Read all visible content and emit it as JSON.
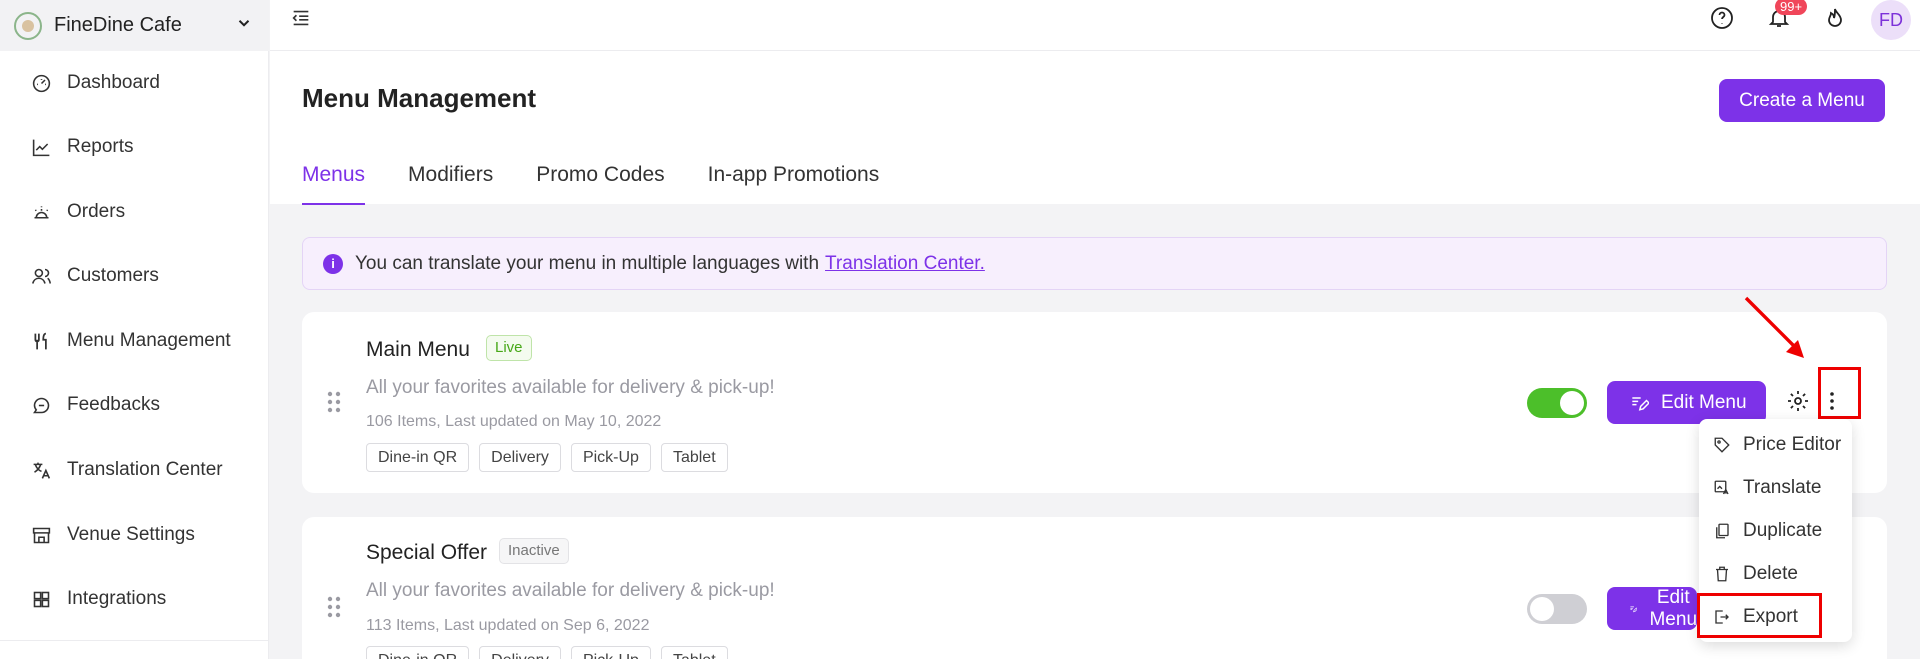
{
  "venue": {
    "name": "FineDine Cafe"
  },
  "sidebar": {
    "items": [
      {
        "label": "Dashboard",
        "icon": "dashboard-icon"
      },
      {
        "label": "Reports",
        "icon": "chart-line-icon"
      },
      {
        "label": "Orders",
        "icon": "bell-service-icon"
      },
      {
        "label": "Customers",
        "icon": "users-icon"
      },
      {
        "label": "Menu Management",
        "icon": "fork-knife-icon"
      },
      {
        "label": "Feedbacks",
        "icon": "chat-icon"
      },
      {
        "label": "Translation Center",
        "icon": "translate-icon"
      },
      {
        "label": "Venue Settings",
        "icon": "store-icon"
      },
      {
        "label": "Integrations",
        "icon": "grid-icon"
      }
    ]
  },
  "topbar": {
    "notification_badge": "99+",
    "avatar": "FD"
  },
  "header": {
    "title": "Menu Management",
    "create_label": "Create a Menu",
    "tabs": [
      {
        "label": "Menus",
        "active": true
      },
      {
        "label": "Modifiers",
        "active": false
      },
      {
        "label": "Promo Codes",
        "active": false
      },
      {
        "label": "In-app Promotions",
        "active": false
      }
    ]
  },
  "banner": {
    "text": "You can translate your menu in multiple languages with",
    "link": "Translation Center."
  },
  "menus": [
    {
      "name": "Main Menu",
      "status": "Live",
      "description": "All your favorites available for delivery & pick-up!",
      "meta": "106 Items, Last updated on May 10, 2022",
      "channels": [
        "Dine-in QR",
        "Delivery",
        "Pick-Up",
        "Tablet"
      ],
      "enabled": true,
      "edit_label": "Edit Menu"
    },
    {
      "name": "Special Offer",
      "status": "Inactive",
      "description": "All your favorites available for delivery & pick-up!",
      "meta": "113 Items, Last updated on Sep 6, 2022",
      "channels": [
        "Dine-in QR",
        "Delivery",
        "Pick-Up",
        "Tablet"
      ],
      "enabled": false,
      "edit_label": "Edit Menu"
    }
  ],
  "dropdown": {
    "items": [
      {
        "label": "Price Editor",
        "icon": "tag-icon"
      },
      {
        "label": "Translate",
        "icon": "translate-image-icon"
      },
      {
        "label": "Duplicate",
        "icon": "copy-icon"
      },
      {
        "label": "Delete",
        "icon": "trash-icon"
      },
      {
        "label": "Export",
        "icon": "export-icon"
      }
    ]
  },
  "colors": {
    "accent": "#7d32e8",
    "live_green": "#47a818",
    "toggle_on": "#4cbf2a",
    "highlight": "#e00000",
    "badge": "#f0465a"
  }
}
